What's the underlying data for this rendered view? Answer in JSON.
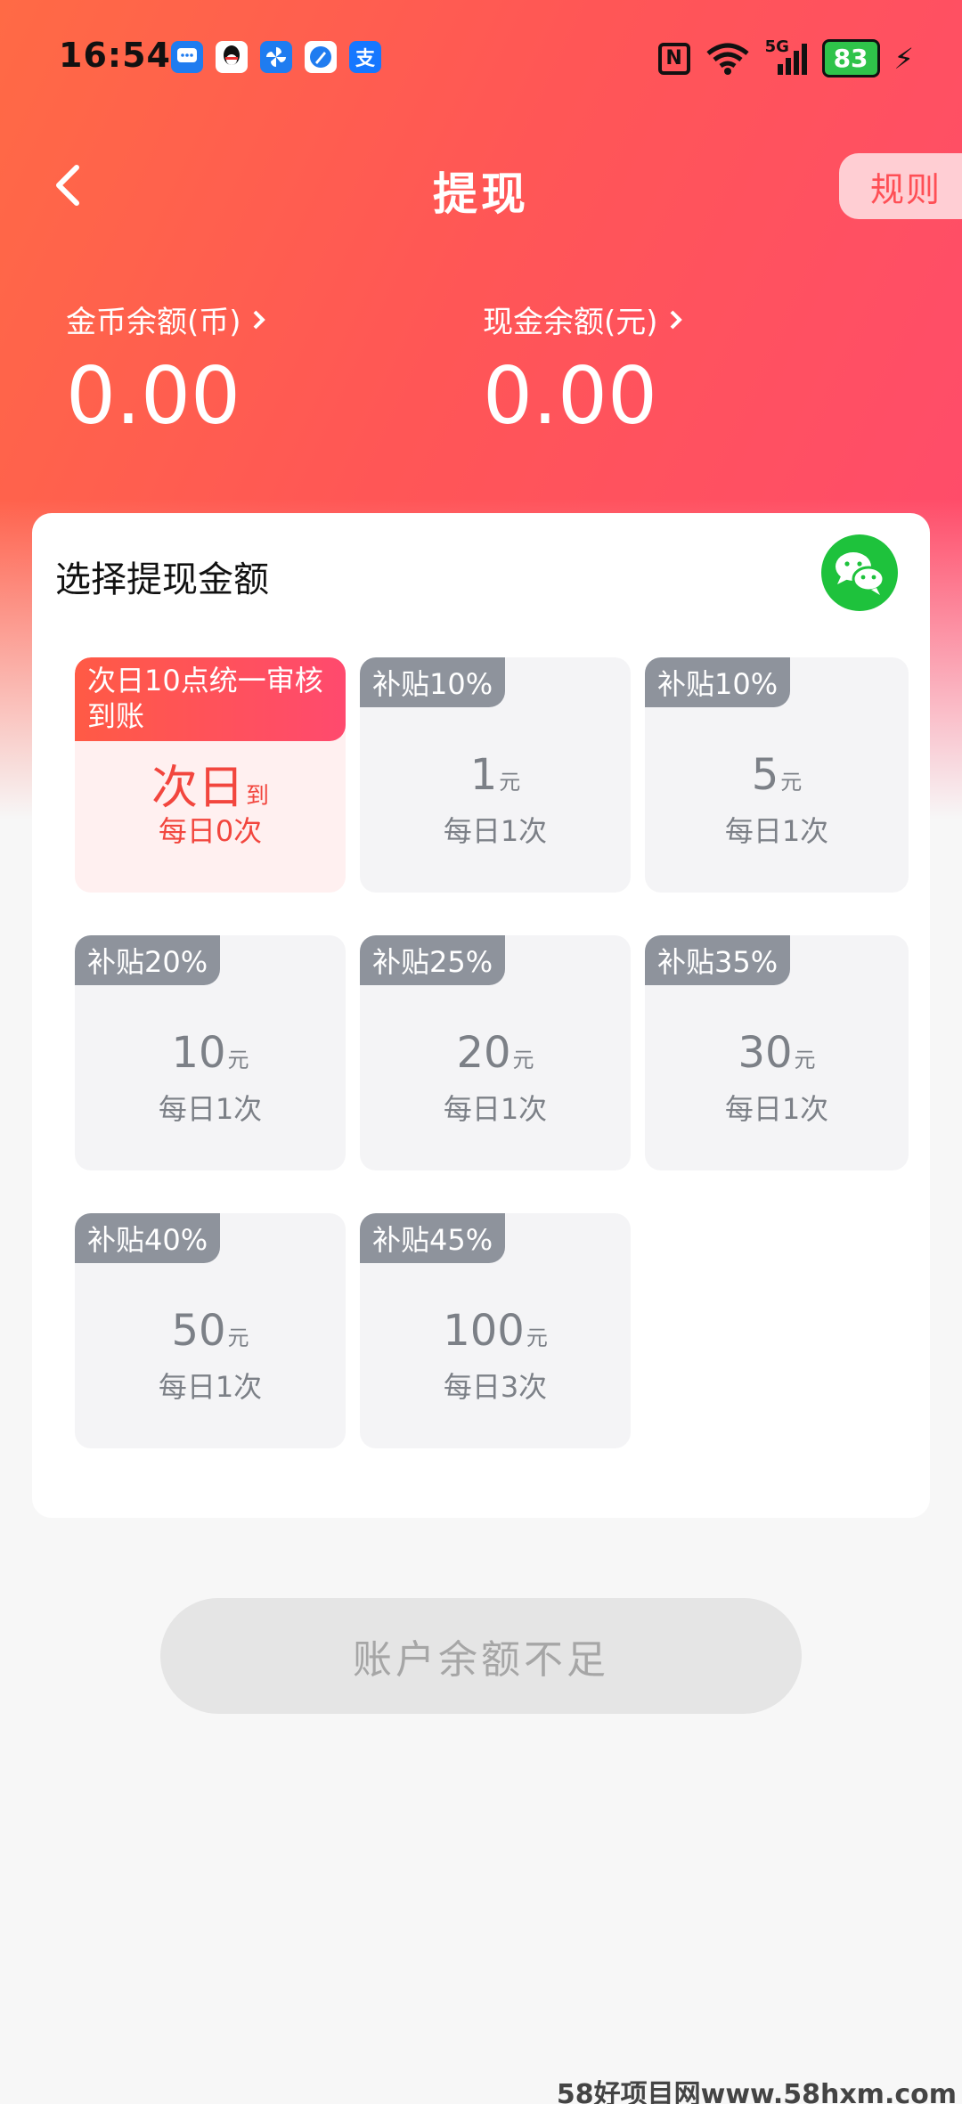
{
  "status_bar": {
    "time": "16:54",
    "network": "5G",
    "battery": "83",
    "apps": [
      "message-icon",
      "qq-icon",
      "pinwheel-icon",
      "browser-icon",
      "alipay-icon"
    ],
    "alipay_glyph": "支"
  },
  "header": {
    "title": "提现",
    "rule_label": "规则"
  },
  "balances": {
    "coin": {
      "label": "金币余额(币)",
      "value": "0.00"
    },
    "cash": {
      "label": "现金余额(元)",
      "value": "0.00"
    }
  },
  "withdraw": {
    "title": "选择提现金额",
    "method_icon": "wechat-icon",
    "options": [
      {
        "tag": "次日10点统一审核到账",
        "amount": "次日",
        "unit": "到",
        "freq": "每日0次",
        "selected": true
      },
      {
        "tag": "补贴10%",
        "amount": "1",
        "unit": "元",
        "freq": "每日1次"
      },
      {
        "tag": "补贴10%",
        "amount": "5",
        "unit": "元",
        "freq": "每日1次"
      },
      {
        "tag": "补贴20%",
        "amount": "10",
        "unit": "元",
        "freq": "每日1次"
      },
      {
        "tag": "补贴25%",
        "amount": "20",
        "unit": "元",
        "freq": "每日1次"
      },
      {
        "tag": "补贴35%",
        "amount": "30",
        "unit": "元",
        "freq": "每日1次"
      },
      {
        "tag": "补贴40%",
        "amount": "50",
        "unit": "元",
        "freq": "每日1次"
      },
      {
        "tag": "补贴45%",
        "amount": "100",
        "unit": "元",
        "freq": "每日3次"
      }
    ]
  },
  "submit": {
    "label": "账户余额不足"
  },
  "watermark": "58好项目网www.58hxm.com",
  "colors": {
    "accent": "#ff5656",
    "selected_text": "#f2463e",
    "tag_gray": "#8e939c",
    "wechat": "#1ec23c"
  }
}
